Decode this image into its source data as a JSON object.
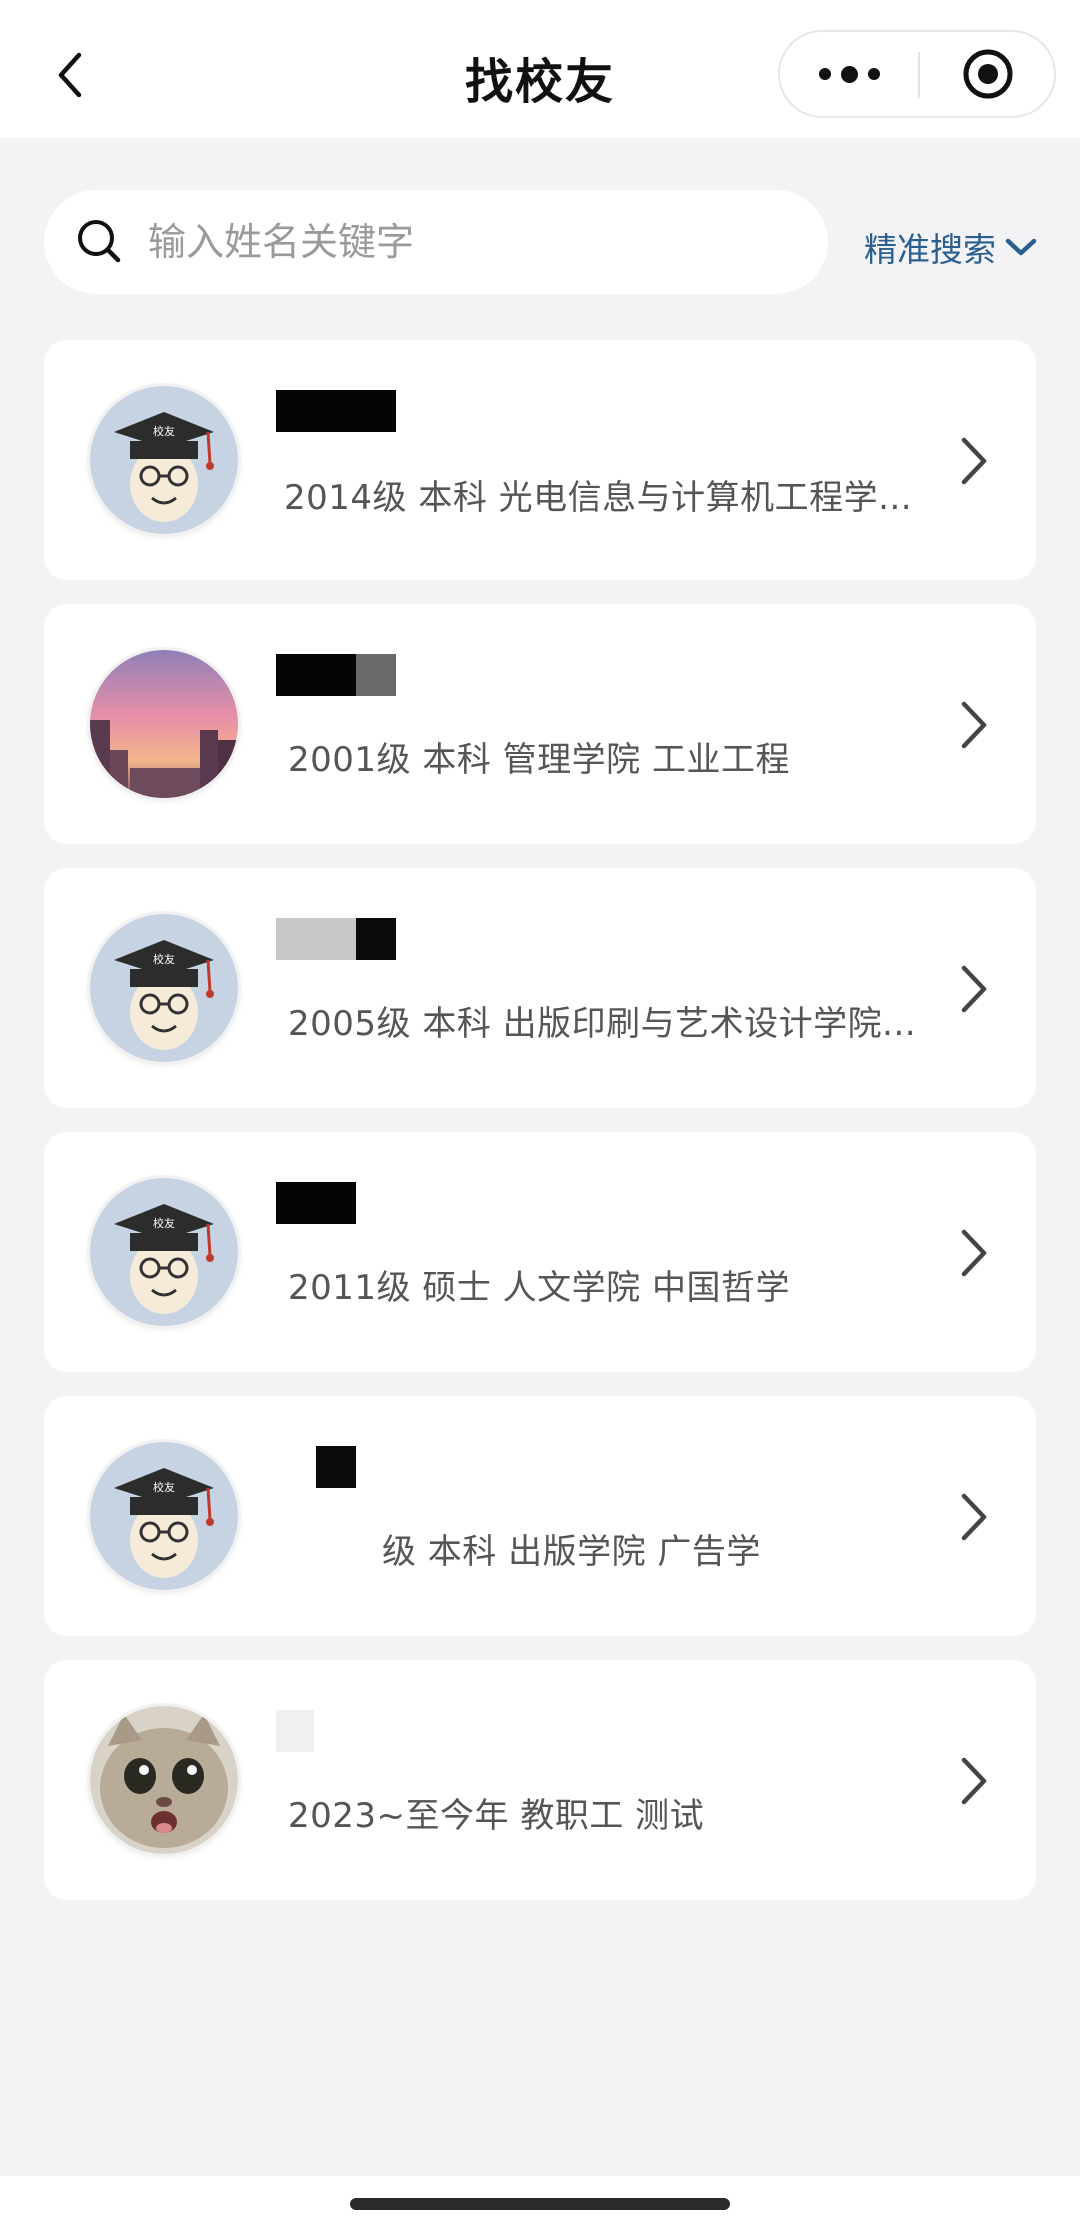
{
  "header": {
    "title": "找校友",
    "back_icon": "chevron-left-icon",
    "more_icon": "more-dots-icon",
    "close_icon": "target-close-icon"
  },
  "search": {
    "placeholder": "输入姓名关键字",
    "value": "",
    "icon": "search-icon",
    "precise_label": "精准搜索",
    "precise_icon": "chevron-down-icon"
  },
  "colors": {
    "background": "#f3f3f5",
    "card": "#ffffff",
    "accent": "#2b5f8f",
    "text_secondary": "#555555"
  },
  "alumni": [
    {
      "avatar": "graduate-cartoon-avatar",
      "info": "2014级 本科 光电信息与计算机工程学..."
    },
    {
      "avatar": "sunset-city-photo-avatar",
      "info": "2001级 本科 管理学院 工业工程"
    },
    {
      "avatar": "graduate-cartoon-avatar",
      "info": "2005级 本科 出版印刷与艺术设计学院..."
    },
    {
      "avatar": "graduate-cartoon-avatar",
      "info": "2011级 硕士 人文学院 中国哲学"
    },
    {
      "avatar": "graduate-cartoon-avatar",
      "info": "级 本科 出版学院 广告学"
    },
    {
      "avatar": "surprised-cat-photo-avatar",
      "info": "2023~至今年 教职工 测试"
    }
  ]
}
